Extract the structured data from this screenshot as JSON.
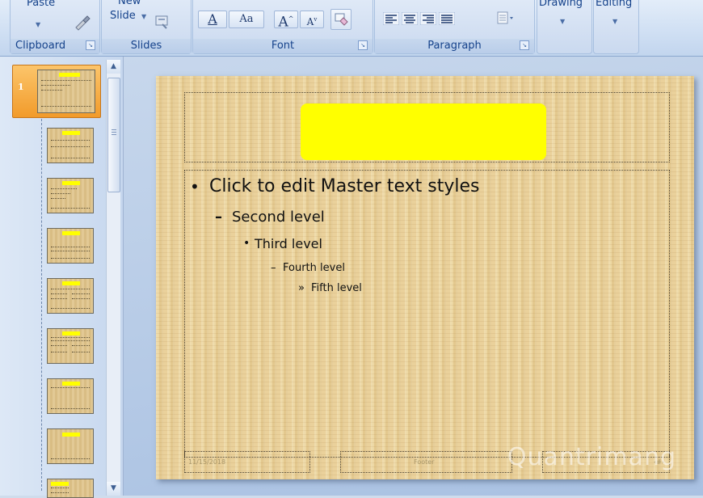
{
  "ribbon": {
    "clipboard": {
      "paste_label": "Paste",
      "group_label": "Clipboard"
    },
    "slides": {
      "new_slide_line1": "New",
      "new_slide_line2": "Slide",
      "group_label": "Slides"
    },
    "font": {
      "group_label": "Font",
      "font_color_glyph": "A",
      "change_case_glyph": "Aa",
      "grow_glyph": "A",
      "shrink_glyph": "A"
    },
    "paragraph": {
      "group_label": "Paragraph"
    },
    "drawing": {
      "label": "Drawing"
    },
    "editing": {
      "label": "Editing"
    }
  },
  "thumbnails": {
    "selected_number": "1",
    "count": 9
  },
  "slide": {
    "bullet_l1": "•",
    "level1": "Click to edit Master text styles",
    "bullet_l2": "–",
    "level2": "Second level",
    "bullet_l3": "•",
    "level3": "Third level",
    "bullet_l4": "–",
    "level4": "Fourth level",
    "bullet_l5": "»",
    "level5": "Fifth level",
    "footer_date": "11/15/2018",
    "footer_text": "Footer",
    "footer_page": "‹#›",
    "watermark": "Quantrimang"
  },
  "colors": {
    "title_highlight": "#ffff00",
    "selected_thumb": "#f7a93c",
    "ribbon_text": "#15428b"
  }
}
